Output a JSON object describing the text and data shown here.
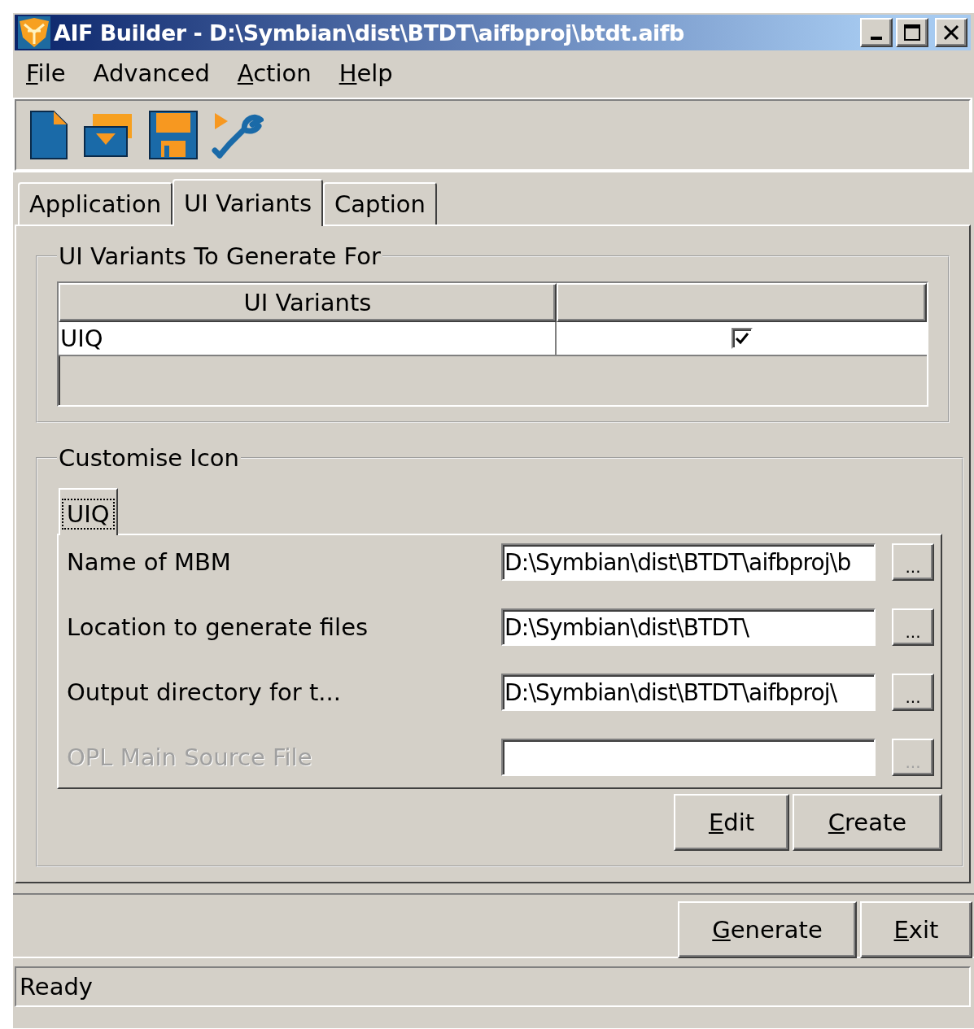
{
  "window": {
    "title": "AIF Builder - D:\\Symbian\\dist\\BTDT\\aifbproj\\btdt.aifb"
  },
  "menu": [
    {
      "label": "File",
      "underlined": true
    },
    {
      "label": "Advanced",
      "underlined": false
    },
    {
      "label": "Action",
      "underlined": true
    },
    {
      "label": "Help",
      "underlined": true
    }
  ],
  "tabs": [
    {
      "label": "Application",
      "selected": false
    },
    {
      "label": "UI Variants",
      "selected": true
    },
    {
      "label": "Caption",
      "selected": false
    }
  ],
  "variants_group": {
    "title": "UI Variants To Generate For",
    "table": {
      "columns": [
        "UI Variants"
      ],
      "rows": [
        {
          "name": "UIQ",
          "checked": true
        }
      ]
    }
  },
  "icon_group": {
    "title": "Customise Icon",
    "tabs": [
      {
        "label": "UIQ",
        "selected": true
      }
    ],
    "fields": [
      {
        "label": "Name of MBM",
        "value": "D:\\Symbian\\dist\\BTDT\\aifbproj\\b",
        "browse": "...",
        "disabled": false
      },
      {
        "label": "Location to generate files",
        "value": "D:\\Symbian\\dist\\BTDT\\",
        "browse": "...",
        "disabled": false
      },
      {
        "label": "Output directory for t...",
        "value": "D:\\Symbian\\dist\\BTDT\\aifbproj\\",
        "browse": "...",
        "disabled": false
      },
      {
        "label": "OPL Main Source File",
        "browse": "...",
        "disabled": true
      }
    ],
    "buttons": [
      {
        "label": "Edit",
        "underlined": true
      },
      {
        "label": "Create",
        "underlined": true
      }
    ]
  },
  "buttons": [
    {
      "label": "Generate",
      "underlined": true
    },
    {
      "label": "Exit",
      "underlined": true
    }
  ],
  "status_bar": {
    "text": "Ready"
  }
}
